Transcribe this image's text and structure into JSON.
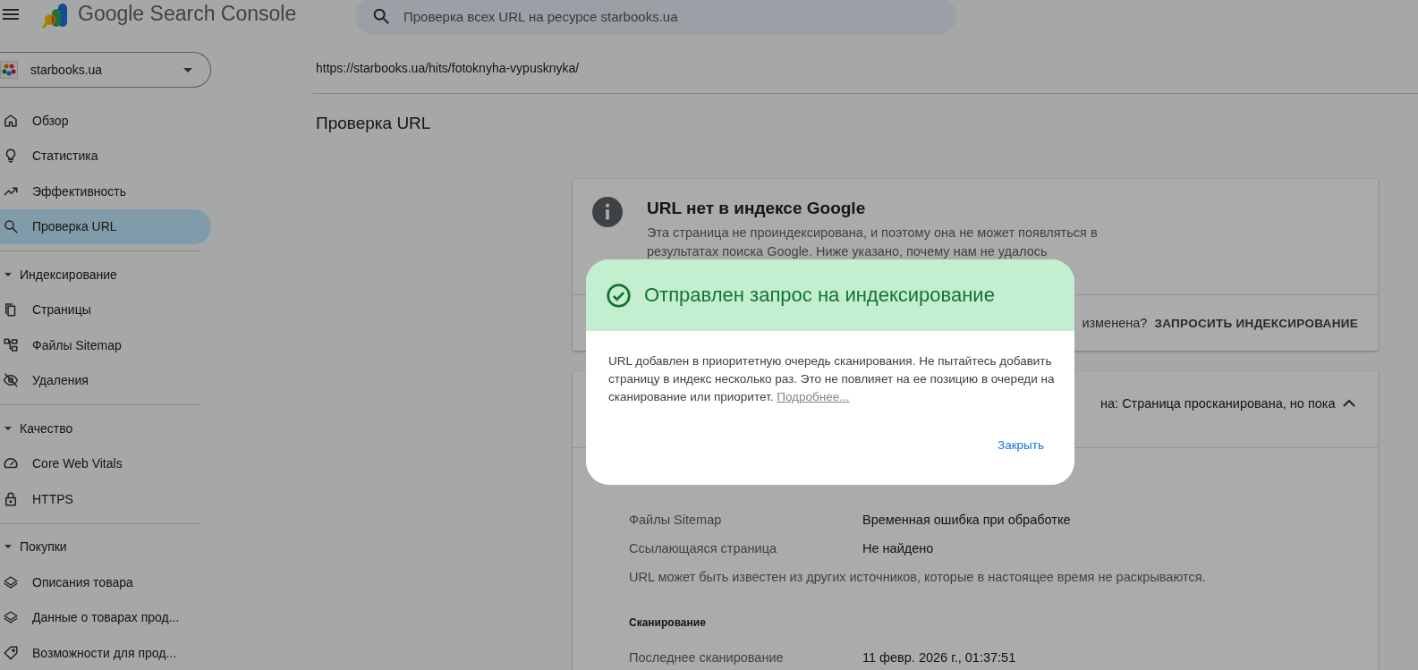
{
  "header": {
    "app_name": "Google Search Console",
    "search": {
      "placeholder": "Проверка всех URL на ресурсе starbooks.ua"
    }
  },
  "property": {
    "name": "starbooks.ua"
  },
  "nav": {
    "items": [
      {
        "label": "Обзор",
        "selected": false
      },
      {
        "label": "Статистика",
        "selected": false
      },
      {
        "label": "Эффективность",
        "selected": false
      },
      {
        "label": "Проверка URL",
        "selected": true
      }
    ],
    "sections": [
      {
        "title": "Индексирование",
        "expanded": true,
        "items": [
          {
            "label": "Страницы",
            "selected": false
          },
          {
            "label": "Файлы Sitemap",
            "selected": false
          },
          {
            "label": "Удаления",
            "selected": false
          }
        ]
      },
      {
        "title": "Качество",
        "expanded": true,
        "items": [
          {
            "label": "Core Web Vitals",
            "selected": false
          },
          {
            "label": "HTTPS",
            "selected": false
          }
        ]
      },
      {
        "title": "Покупки",
        "expanded": true,
        "items": [
          {
            "label": "Описания товара",
            "selected": false
          },
          {
            "label": "Данные о товарах прод...",
            "selected": false
          },
          {
            "label": "Возможности для прод...",
            "selected": false
          }
        ]
      }
    ]
  },
  "main": {
    "url": "https://starbooks.ua/hits/fotoknyha-vypusknyka/",
    "page_title": "Проверка URL",
    "status_card": {
      "title": "URL нет в индексе Google",
      "description": "Эта страница не проиндексирована, и поэтому она не может появляться в результатах поиска Google. Ниже указано, почему нам не удалось",
      "question": "изменена?",
      "request_button": "ЗАПРОСИТЬ ИНДЕКСИРОВАНИЕ"
    },
    "coverage_card": {
      "title": "на: Страница просканирована, но пока",
      "expanded": true,
      "rows": [
        {
          "label": "Файлы Sitemap",
          "value": "Временная ошибка при обработке"
        },
        {
          "label": "Ссылающаяся страница",
          "value": "Не найдено"
        }
      ],
      "note": "URL может быть известен из других источников, которые в настоящее время не раскрываются.",
      "crawl": {
        "heading": "Сканирование",
        "rows": [
          {
            "label": "Последнее сканирование",
            "value": "11 февр. 2026 г., 01:37:51"
          }
        ]
      }
    }
  },
  "dialog": {
    "title": "Отправлен запрос на индексирование",
    "body": "URL добавлен в приоритетную очередь сканирования. Не пытайтесь добавить страницу в индекс несколько раз. Это не повлияет на ее позицию в очереди на сканирование или приоритет.",
    "link": "Подробнее...",
    "close_button": "Закрыть"
  }
}
